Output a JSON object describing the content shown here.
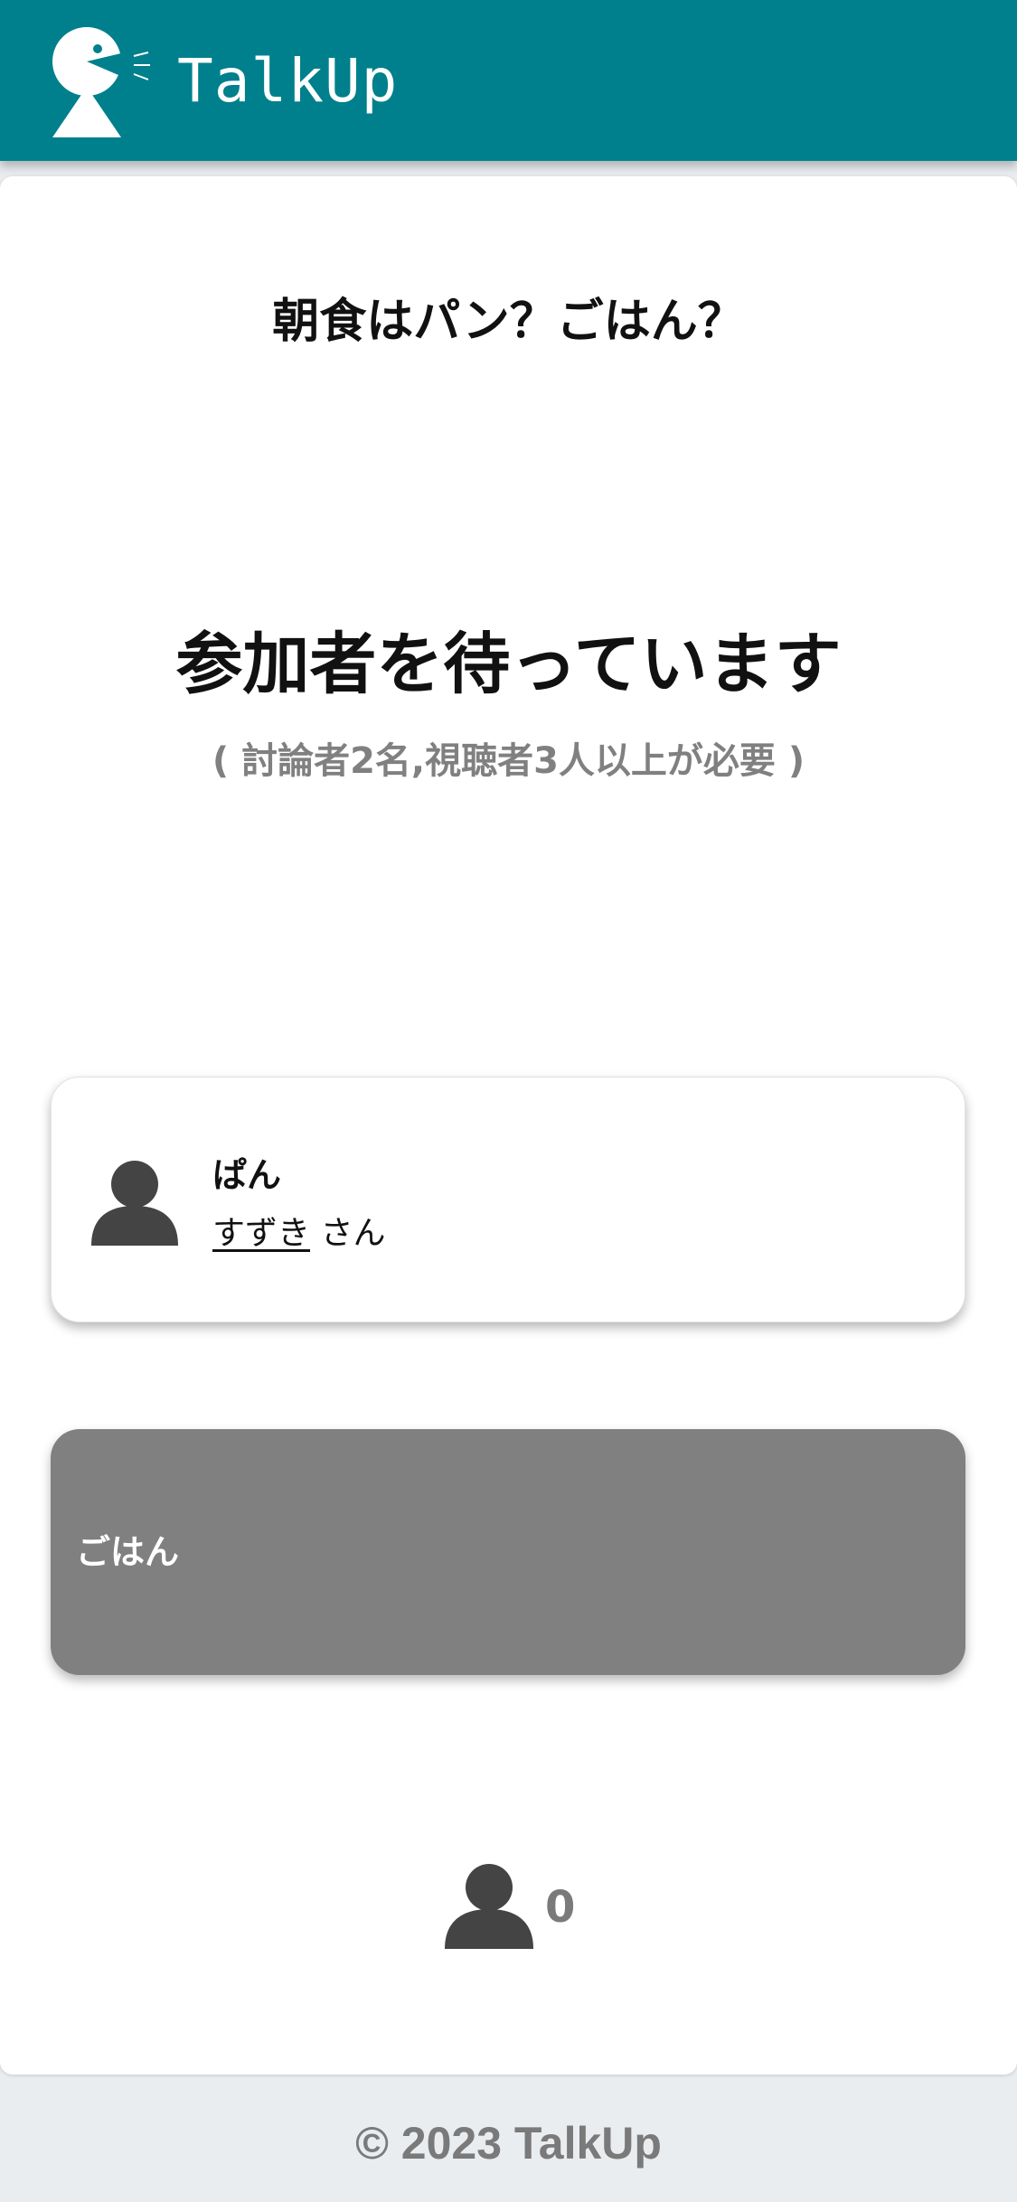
{
  "header": {
    "brand": "TalkUp",
    "logo_icon": "talking-person-icon",
    "background_color": "#00808c"
  },
  "topic": {
    "title": "朝食はパン？ごはん？"
  },
  "status": {
    "title": "参加者を待っています",
    "note": "( 討論者2名,視聴者3人以上が必要 )"
  },
  "sides": [
    {
      "label": "ぱん",
      "user_name": "すずき",
      "user_suffix": " さん",
      "icon": "person-icon",
      "background_color": "#ffffff"
    },
    {
      "label": "ごはん",
      "background_color": "#808080"
    }
  ],
  "viewers": {
    "icon": "person-icon",
    "count": "0"
  },
  "footer": {
    "copyright": "© 2023 TalkUp"
  }
}
